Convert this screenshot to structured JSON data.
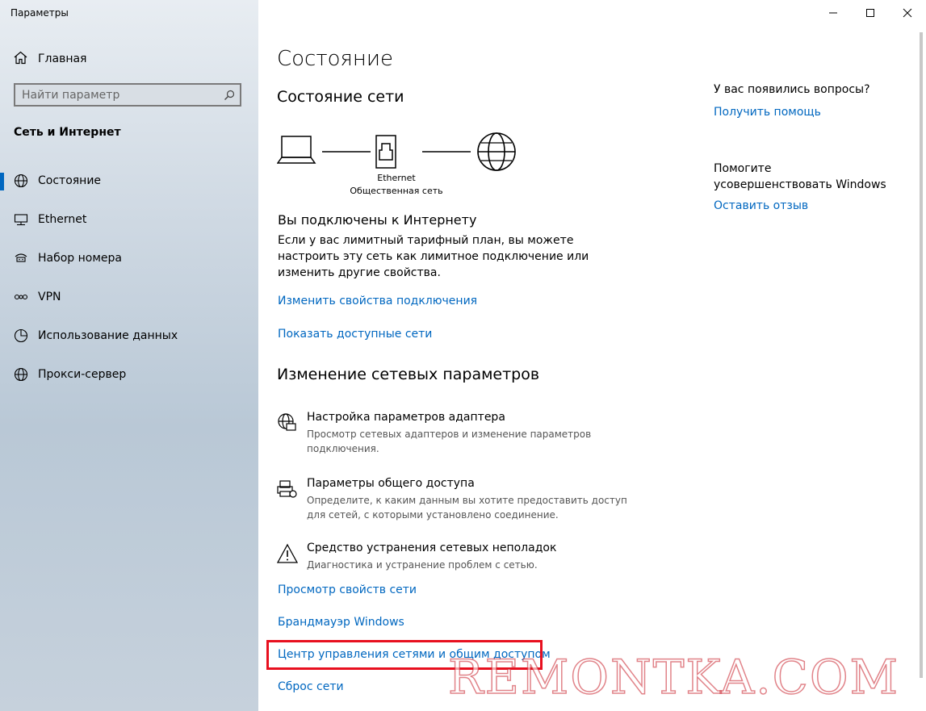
{
  "window": {
    "title": "Параметры"
  },
  "sidebar": {
    "home_label": "Главная",
    "search_placeholder": "Найти параметр",
    "section_title": "Сеть и Интернет",
    "items": [
      {
        "label": "Состояние",
        "icon": "globe-icon",
        "active": true
      },
      {
        "label": "Ethernet",
        "icon": "ethernet-icon"
      },
      {
        "label": "Набор номера",
        "icon": "dialup-icon"
      },
      {
        "label": "VPN",
        "icon": "vpn-icon"
      },
      {
        "label": "Использование данных",
        "icon": "data-usage-icon"
      },
      {
        "label": "Прокси-сервер",
        "icon": "globe-icon"
      }
    ]
  },
  "main": {
    "page_title": "Состояние",
    "network_status_title": "Состояние сети",
    "diagram": {
      "adapter_name": "Ethernet",
      "network_type": "Общественная сеть"
    },
    "connected_title": "Вы подключены к Интернету",
    "connected_desc": "Если у вас лимитный тарифный план, вы можете настроить эту сеть как лимитное подключение или изменить другие свойства.",
    "links_top": {
      "change_properties": "Изменить свойства подключения",
      "show_networks": "Показать доступные сети"
    },
    "change_settings_title": "Изменение сетевых параметров",
    "settings": [
      {
        "title": "Настройка параметров адаптера",
        "desc": "Просмотр сетевых адаптеров и изменение параметров подключения."
      },
      {
        "title": "Параметры общего доступа",
        "desc": "Определите, к каким данным вы хотите предоставить доступ для сетей, с которыми установлено соединение."
      },
      {
        "title": "Средство устранения сетевых неполадок",
        "desc": "Диагностика и устранение проблем с сетью."
      }
    ],
    "links_bottom": {
      "view_properties": "Просмотр свойств сети",
      "firewall": "Брандмауэр Windows",
      "network_center": "Центр управления сетями и общим доступом",
      "reset": "Сброс сети"
    }
  },
  "right": {
    "questions": "У вас появились вопросы?",
    "get_help": "Получить помощь",
    "improve": "Помогите усовершенствовать Windows",
    "feedback": "Оставить отзыв"
  },
  "watermark": "REMONTKA.COM",
  "colors": {
    "accent": "#0067c0",
    "highlight": "#e8101f"
  }
}
